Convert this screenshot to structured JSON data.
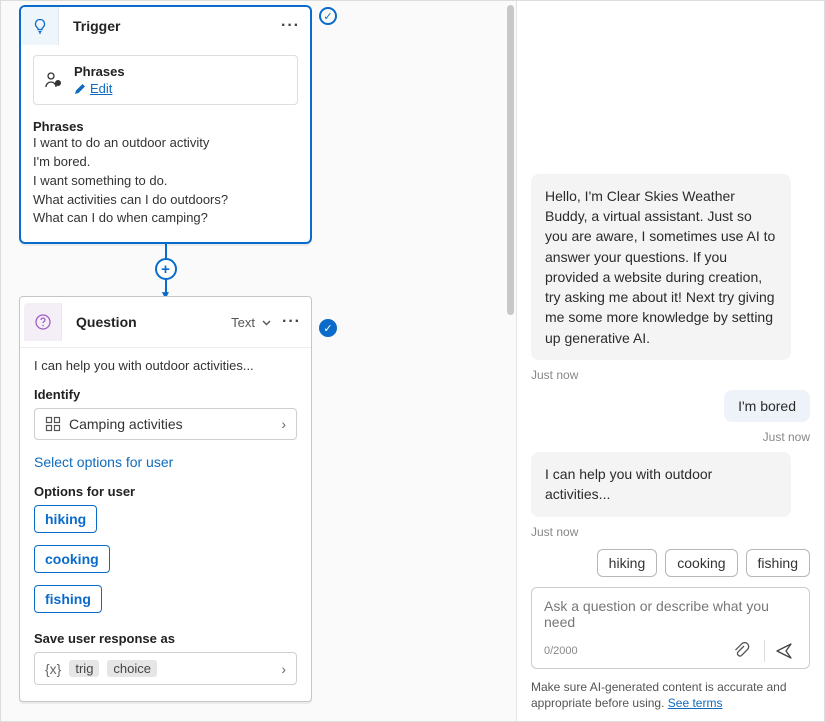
{
  "trigger": {
    "title": "Trigger",
    "phrases_card_title": "Phrases",
    "edit_label": "Edit",
    "phrases_heading": "Phrases",
    "phrases": [
      "I want to do an outdoor activity",
      "I'm bored.",
      "I want something to do.",
      "What activities can I do outdoors?",
      "What can I do when camping?"
    ]
  },
  "question": {
    "title": "Question",
    "type_label": "Text",
    "help_text": "I can help you with outdoor activities...",
    "identify_label": "Identify",
    "identify_value": "Camping activities",
    "select_options_link": "Select options for user",
    "options_label": "Options for user",
    "options": [
      "hiking",
      "cooking",
      "fishing"
    ],
    "save_label": "Save user response as",
    "var_parts": [
      "trig",
      "choice"
    ]
  },
  "chat": {
    "bot_intro": "Hello, I'm Clear Skies Weather Buddy, a virtual assistant. Just so you are aware, I sometimes use AI to answer your questions. If you provided a website during creation, try asking me about it! Next try giving me some more knowledge by setting up generative AI.",
    "ts1": "Just now",
    "user1": "I'm bored",
    "ts2": "Just now",
    "bot2": "I can help you with outdoor activities...",
    "ts3": "Just now",
    "chips": [
      "hiking",
      "cooking",
      "fishing"
    ],
    "input_placeholder": "Ask a question or describe what you need",
    "char_count": "0/2000",
    "terms_text": "Make sure AI-generated content is accurate and appropriate before using. ",
    "terms_link": "See terms"
  }
}
